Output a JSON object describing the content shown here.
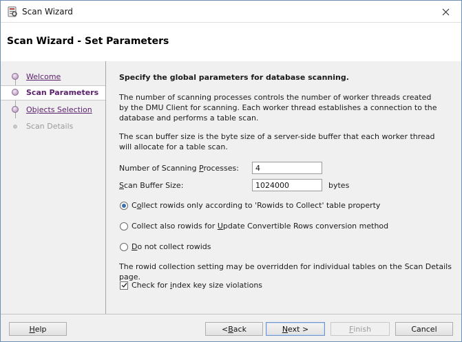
{
  "window": {
    "title": "Scan Wizard"
  },
  "header": {
    "title": "Scan Wizard - Set Parameters"
  },
  "steps": [
    {
      "label": "Welcome",
      "state": "link"
    },
    {
      "label": "Scan Parameters",
      "state": "current"
    },
    {
      "label": "Objects Selection",
      "state": "link"
    },
    {
      "label": "Scan Details",
      "state": "disabled"
    }
  ],
  "content": {
    "heading": "Specify the global parameters for database scanning.",
    "para1": "The number of scanning processes controls the number of worker threads created by the DMU Client for scanning. Each worker thread establishes a connection to the database and performs a table scan.",
    "para2": "The scan buffer size is the byte size of a server-side buffer that each worker thread will allocate for a table scan.",
    "processes_label_pre": "Number of Scanning ",
    "processes_label_u": "P",
    "processes_label_post": "rocesses:",
    "processes_value": "4",
    "buffer_label_u": "S",
    "buffer_label_post": "can Buffer Size:",
    "buffer_value": "1024000",
    "buffer_units": "bytes",
    "radio1_pre": "C",
    "radio1_u": "o",
    "radio1_post": "llect rowids only according to 'Rowids to Collect' table property",
    "radio1_selected": true,
    "radio2_pre": "Collect also rowids for ",
    "radio2_u": "U",
    "radio2_post": "pdate Convertible Rows conversion method",
    "radio2_selected": false,
    "radio3_u": "D",
    "radio3_post": "o not collect rowids",
    "radio3_selected": false,
    "override_note": "The rowid collection setting may be overridden for individual tables on the Scan Details page.",
    "check_pre": "Check for ",
    "check_u": "i",
    "check_post": "ndex key size violations",
    "check_checked": true
  },
  "footer": {
    "help_u": "H",
    "help_post": "elp",
    "back_pre": "< ",
    "back_u": "B",
    "back_post": "ack",
    "next_u": "N",
    "next_post": "ext >",
    "finish_u": "F",
    "finish_post": "inish",
    "cancel": "Cancel"
  }
}
